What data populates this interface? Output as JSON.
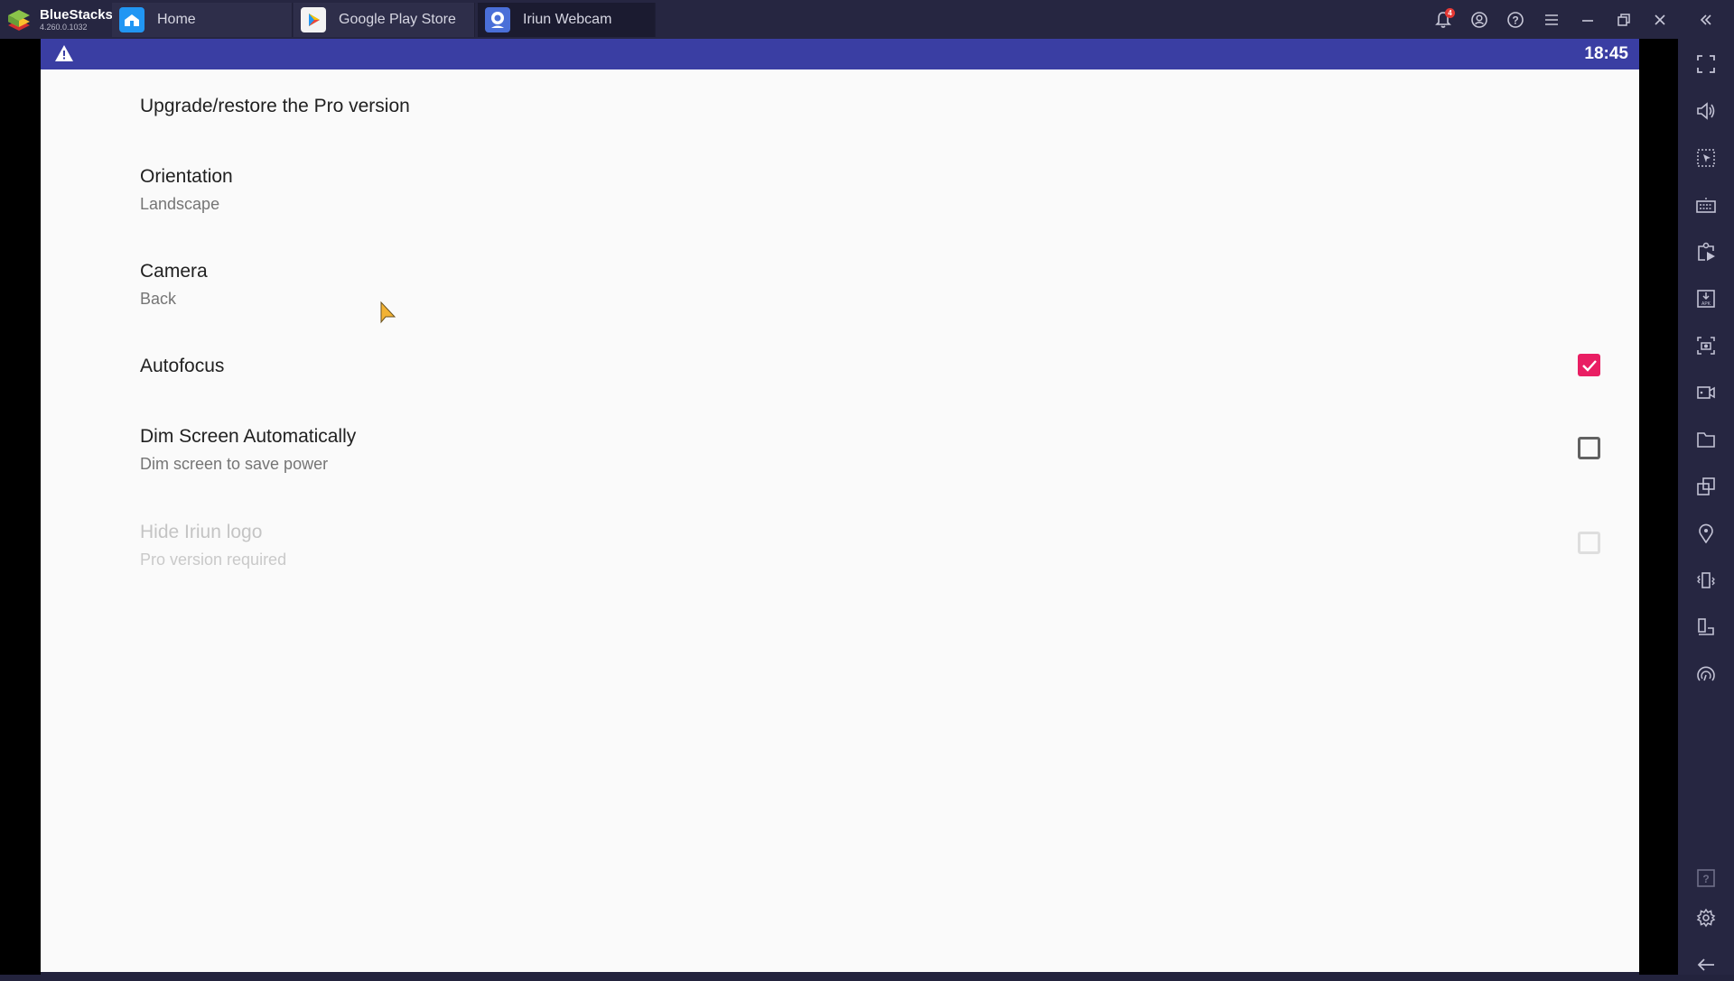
{
  "app": {
    "name": "BlueStacks",
    "version": "4.260.0.1032"
  },
  "tabs": [
    {
      "label": "Home",
      "icon": "home-icon",
      "active": false
    },
    {
      "label": "Google Play Store",
      "icon": "play-store-icon",
      "active": false
    },
    {
      "label": "Iriun Webcam",
      "icon": "webcam-icon",
      "active": true
    }
  ],
  "titlebar": {
    "notification_count": "4",
    "icons": [
      "bell-icon",
      "account-icon",
      "help-icon",
      "menu-icon",
      "minimize-icon",
      "restore-icon",
      "close-icon",
      "collapse-sidebar-icon"
    ]
  },
  "statusbar": {
    "time": "18:45",
    "warning_icon": "warning-icon"
  },
  "settings": [
    {
      "title": "Upgrade/restore the Pro version",
      "summary": null
    },
    {
      "title": "Orientation",
      "summary": "Landscape"
    },
    {
      "title": "Camera",
      "summary": "Back"
    },
    {
      "title": "Autofocus",
      "summary": null,
      "checkbox": true
    },
    {
      "title": "Dim Screen Automatically",
      "summary": "Dim screen to save power",
      "checkbox": false
    },
    {
      "title": "Hide Iriun logo",
      "summary": "Pro version required",
      "checkbox": false,
      "disabled": true
    }
  ],
  "sidebar": {
    "icons": [
      "fullscreen-icon",
      "volume-icon",
      "pointer-select-icon",
      "keyboard-icon",
      "macro-play-icon",
      "install-apk-icon",
      "screenshot-icon",
      "record-video-icon",
      "folder-icon",
      "multi-instance-icon",
      "location-icon",
      "shake-icon",
      "rotate-icon",
      "performance-icon",
      "help-icon",
      "settings-icon",
      "back-icon"
    ]
  },
  "colors": {
    "accent": "#e91e63",
    "statusbar": "#3a3ea3",
    "titlebar": "#262641"
  }
}
